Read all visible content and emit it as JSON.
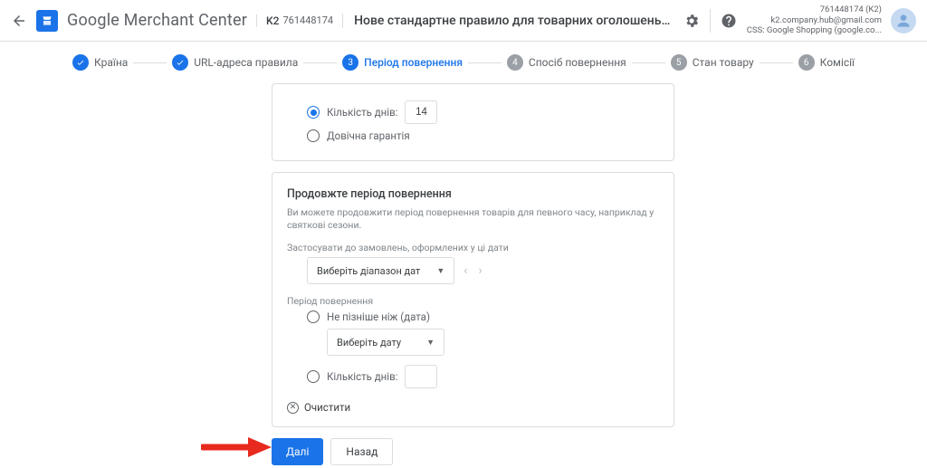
{
  "header": {
    "app_name": "Google Merchant Center",
    "account_chip_label": "K2",
    "account_chip_id": "761448174",
    "page_title": "Нове стандартне правило для товарних оголошень та інформації про товар, ро...",
    "acct_line1": "761448174 (K2)",
    "acct_line2": "k2.company.hub@gmail.com",
    "acct_line3": "CSS: Google Shopping (google.co..."
  },
  "stepper": {
    "steps": [
      {
        "label": "Країна"
      },
      {
        "label": "URL-адреса правила"
      },
      {
        "num": "3",
        "label": "Період повернення"
      },
      {
        "num": "4",
        "label": "Спосіб повернення"
      },
      {
        "num": "5",
        "label": "Стан товару"
      },
      {
        "num": "6",
        "label": "Комісії"
      }
    ]
  },
  "card1": {
    "days_label": "Кількість днів:",
    "days_value": "14",
    "lifetime_label": "Довічна гарантія"
  },
  "card2": {
    "title": "Продовжте період повернення",
    "sub": "Ви можете продовжити період повернення товарів для певного часу, наприклад у святкові сезони.",
    "apply_label": "Застосувати до замовлень, оформлених у ці дати",
    "range_placeholder": "Виберіть діапазон дат",
    "period_label": "Період повернення",
    "not_later_label": "Не пізніше ніж (дата)",
    "date_placeholder": "Виберіть дату",
    "days_label": "Кількість днів:",
    "clear_label": "Очистити"
  },
  "buttons": {
    "next": "Далі",
    "back": "Назад"
  }
}
